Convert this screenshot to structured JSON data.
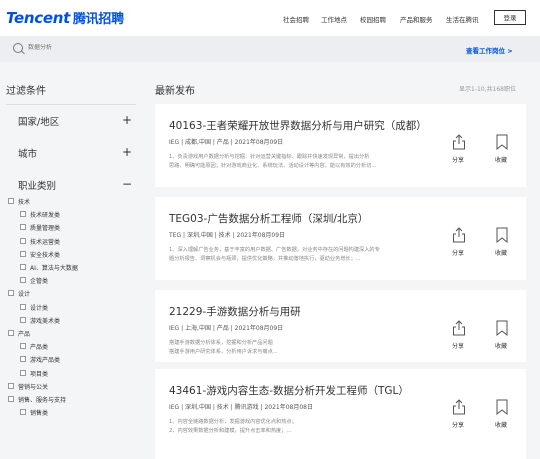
{
  "header": {
    "logo_en": "Tencent",
    "logo_cn": "腾讯招聘",
    "nav": [
      "社会招聘",
      "工作地点",
      "校园招聘",
      "产品和服务",
      "生活在腾讯"
    ],
    "login_label": "登录"
  },
  "search": {
    "placeholder": "数据分析",
    "fav_link": "查看工作岗位 >"
  },
  "sidebar": {
    "title": "过滤条件",
    "categories": [
      {
        "label": "国家/地区",
        "sign": "+"
      },
      {
        "label": "城市",
        "sign": "+"
      },
      {
        "label": "职业类别",
        "sign": "−"
      }
    ],
    "checkboxes": [
      {
        "label": "技术",
        "level": 0
      },
      {
        "label": "技术研发类",
        "level": 1
      },
      {
        "label": "质量管理类",
        "level": 1
      },
      {
        "label": "技术运营类",
        "level": 1
      },
      {
        "label": "安全技术类",
        "level": 1
      },
      {
        "label": "AI、算法与大数据",
        "level": 1
      },
      {
        "label": "企管类",
        "level": 1
      },
      {
        "label": "设计",
        "level": 0
      },
      {
        "label": "设计类",
        "level": 1
      },
      {
        "label": "游戏美术类",
        "level": 1
      },
      {
        "label": "产品",
        "level": 0
      },
      {
        "label": "产品类",
        "level": 1
      },
      {
        "label": "游戏产品类",
        "level": 1
      },
      {
        "label": "项目类",
        "level": 1
      },
      {
        "label": "营销与公关",
        "level": 0
      },
      {
        "label": "销售、服务与支持",
        "level": 0
      },
      {
        "label": "销售类",
        "level": 1
      }
    ]
  },
  "main": {
    "title": "最新发布",
    "count": "显示1-10,共168职位",
    "share_label": "分享",
    "fav_label": "收藏",
    "jobs": [
      {
        "title": "40163-王者荣耀开放世界数据分析与用户研究（成都）",
        "meta": "IEG | 成都,中国 | 产品 | 2021年08月09日",
        "desc": [
          "1、负责游戏用户数据分析与挖掘：针对运营关键指标、跟踪并快速发现异常，提出分析",
          "思路、明确可能原因；针对游戏商业化、系统玩法、活动设计等内容，能以有效的分析切..."
        ]
      },
      {
        "title": "TEG03-广告数据分析工程师（深圳/北京）",
        "meta": "TEG | 深圳,中国 | 技术 | 2021年08月09日",
        "desc": [
          "1、深入理解广告业务，基于丰富的用户数据、广告数据，对业务中存在的问题构建深入的专",
          "题分析报告、洞察机会与瓶颈，提供优化策略，并推动落地执行，驱动业务增长；..."
        ]
      },
      {
        "title": "21229-手游数据分析与用研",
        "meta": "IEG | 上海,中国 | 产品 | 2021年08月09日",
        "desc": [
          "搭建手游数据分析体系，挖掘和分析产品问题",
          "搭建手游用户研究体系，分析用户诉求与痛点..."
        ]
      },
      {
        "title": "43461-游戏内容生态-数据分析开发工程师（TGL）",
        "meta": "IEG | 深圳,中国 | 技术 | 腾讯游戏 | 2021年08月08日",
        "desc": [
          "1、内容全链路数据分析，发掘游戏内容优化点和热点；",
          "2、内容效果数据分析和建模，提升点击率和热度；..."
        ]
      }
    ]
  }
}
